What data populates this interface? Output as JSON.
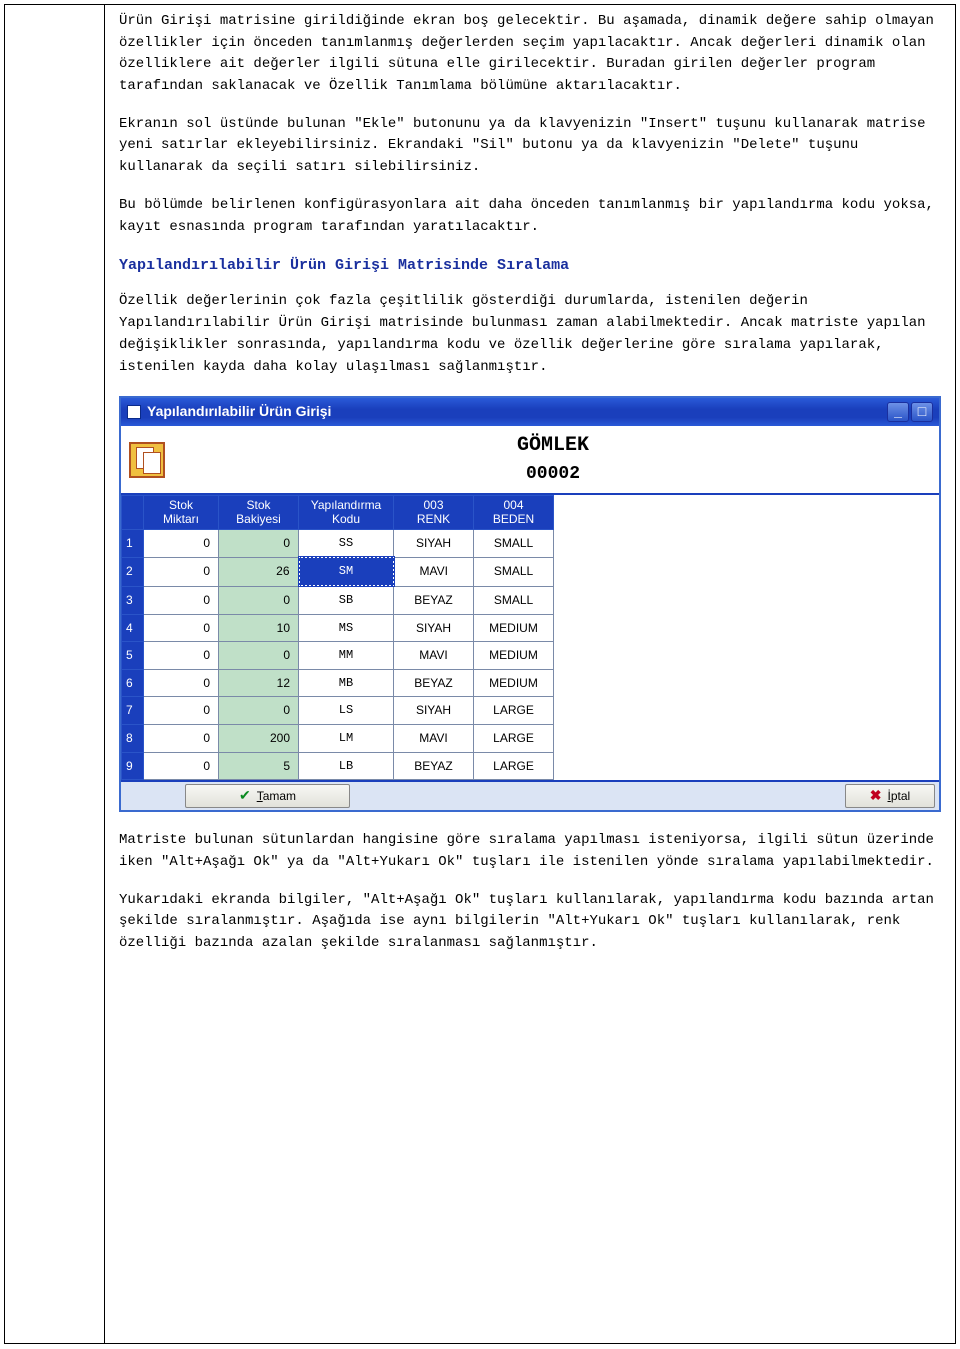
{
  "doc": {
    "p1": "Ürün Girişi matrisine girildiğinde ekran boş gelecektir. Bu aşamada, dinamik değere sahip olmayan özellikler için önceden tanımlanmış değerlerden seçim yapılacaktır. Ancak değerleri dinamik olan özelliklere ait değerler ilgili sütuna elle girilecektir. Buradan girilen değerler program tarafından saklanacak ve Özellik Tanımlama bölümüne aktarılacaktır.",
    "p2": "Ekranın sol üstünde bulunan \"Ekle\" butonunu ya da klavyenizin \"Insert\" tuşunu kullanarak matrise yeni satırlar ekleyebilirsiniz. Ekrandaki \"Sil\" butonu ya da klavyenizin \"Delete\" tuşunu kullanarak da seçili satırı silebilirsiniz.",
    "p3": "Bu bölümde belirlenen konfigürasyonlara ait daha önceden tanımlanmış bir yapılandırma kodu yoksa, kayıt esnasında program tarafından yaratılacaktır.",
    "heading": "Yapılandırılabilir Ürün Girişi Matrisinde Sıralama",
    "p4": "Özellik değerlerinin çok fazla çeşitlilik gösterdiği durumlarda, istenilen değerin Yapılandırılabilir Ürün Girişi matrisinde bulunması zaman alabilmektedir. Ancak matriste yapılan değişiklikler sonrasında, yapılandırma kodu ve özellik değerlerine göre sıralama yapılarak, istenilen kayda daha kolay ulaşılması sağlanmıştır.",
    "p5": "Matriste bulunan sütunlardan hangisine göre sıralama yapılması isteniyorsa, ilgili sütun üzerinde iken \"Alt+Aşağı Ok\" ya da \"Alt+Yukarı Ok\" tuşları ile  istenilen yönde sıralama yapılabilmektedir.",
    "p6": "Yukarıdaki ekranda bilgiler, \"Alt+Aşağı Ok\" tuşları kullanılarak, yapılandırma kodu bazında artan şekilde sıralanmıştır. Aşağıda ise aynı bilgilerin \"Alt+Yukarı Ok\" tuşları kullanılarak, renk özelliği bazında azalan şekilde sıralanması sağlanmıştır."
  },
  "window": {
    "title": "Yapılandırılabilir Ürün Girişi",
    "product_name": "GÖMLEK",
    "product_code": "00002",
    "columns": {
      "blank": "",
      "stok_miktari_l1": "Stok",
      "stok_miktari_l2": "Miktarı",
      "stok_bakiyesi_l1": "Stok",
      "stok_bakiyesi_l2": "Bakiyesi",
      "kod_l1": "Yapılandırma",
      "kod_l2": "Kodu",
      "renk_l1": "003",
      "renk_l2": "RENK",
      "beden_l1": "004",
      "beden_l2": "BEDEN"
    },
    "rows": {
      "r1": {
        "n": "1",
        "miktar": "0",
        "bakiye": "0",
        "kod": "SS",
        "renk": "SIYAH",
        "beden": "SMALL"
      },
      "r2": {
        "n": "2",
        "miktar": "0",
        "bakiye": "26",
        "kod": "SM",
        "renk": "MAVI",
        "beden": "SMALL"
      },
      "r3": {
        "n": "3",
        "miktar": "0",
        "bakiye": "0",
        "kod": "SB",
        "renk": "BEYAZ",
        "beden": "SMALL"
      },
      "r4": {
        "n": "4",
        "miktar": "0",
        "bakiye": "10",
        "kod": "MS",
        "renk": "SIYAH",
        "beden": "MEDIUM"
      },
      "r5": {
        "n": "5",
        "miktar": "0",
        "bakiye": "0",
        "kod": "MM",
        "renk": "MAVI",
        "beden": "MEDIUM"
      },
      "r6": {
        "n": "6",
        "miktar": "0",
        "bakiye": "12",
        "kod": "MB",
        "renk": "BEYAZ",
        "beden": "MEDIUM"
      },
      "r7": {
        "n": "7",
        "miktar": "0",
        "bakiye": "0",
        "kod": "LS",
        "renk": "SIYAH",
        "beden": "LARGE"
      },
      "r8": {
        "n": "8",
        "miktar": "0",
        "bakiye": "200",
        "kod": "LM",
        "renk": "MAVI",
        "beden": "LARGE"
      },
      "r9": {
        "n": "9",
        "miktar": "0",
        "bakiye": "5",
        "kod": "LB",
        "renk": "BEYAZ",
        "beden": "LARGE"
      }
    },
    "buttons": {
      "ok_letter": "T",
      "ok_rest": "amam",
      "cancel_letter": "İ",
      "cancel_rest": "ptal"
    }
  }
}
